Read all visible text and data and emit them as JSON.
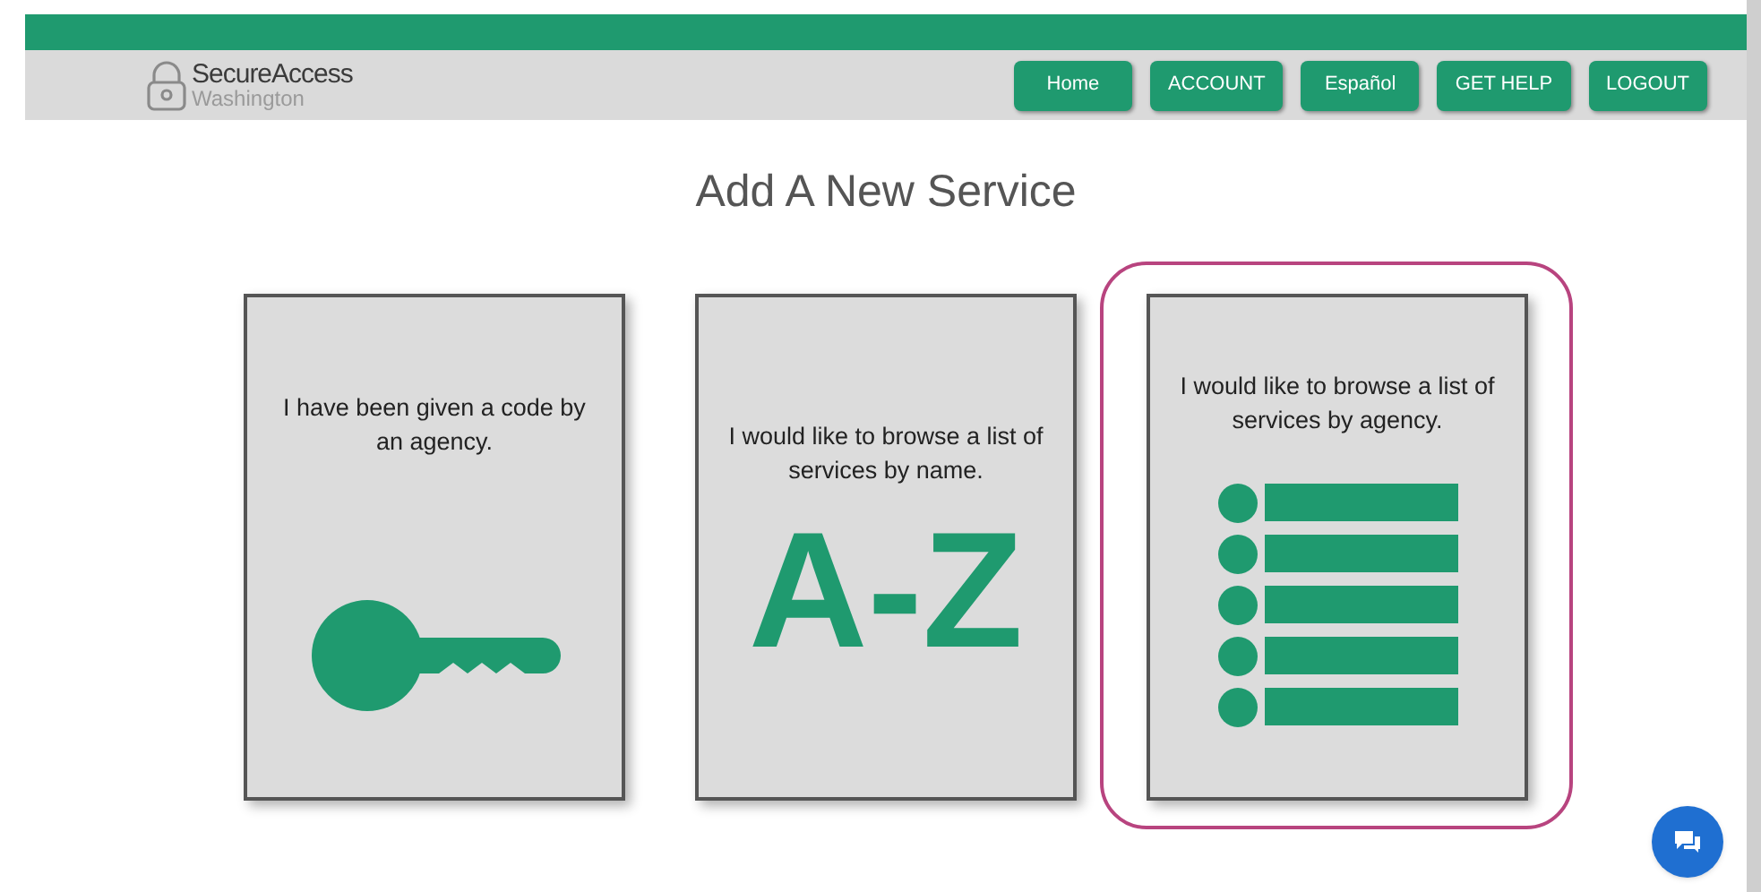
{
  "header": {
    "logo": {
      "name": "SecureAccess",
      "subtitle": "Washington"
    },
    "nav": [
      "Home",
      "ACCOUNT",
      "Español",
      "GET HELP",
      "LOGOUT"
    ]
  },
  "title": "Add A New Service",
  "cards": [
    {
      "kind": "key",
      "text": "I have been given a code by an agency.",
      "selected": false
    },
    {
      "kind": "az",
      "text": "I would like to browse a list of services by name.",
      "glyph": "A-Z",
      "selected": false
    },
    {
      "kind": "list",
      "text": "I would like to browse a list of services by agency.",
      "selected": true
    }
  ]
}
